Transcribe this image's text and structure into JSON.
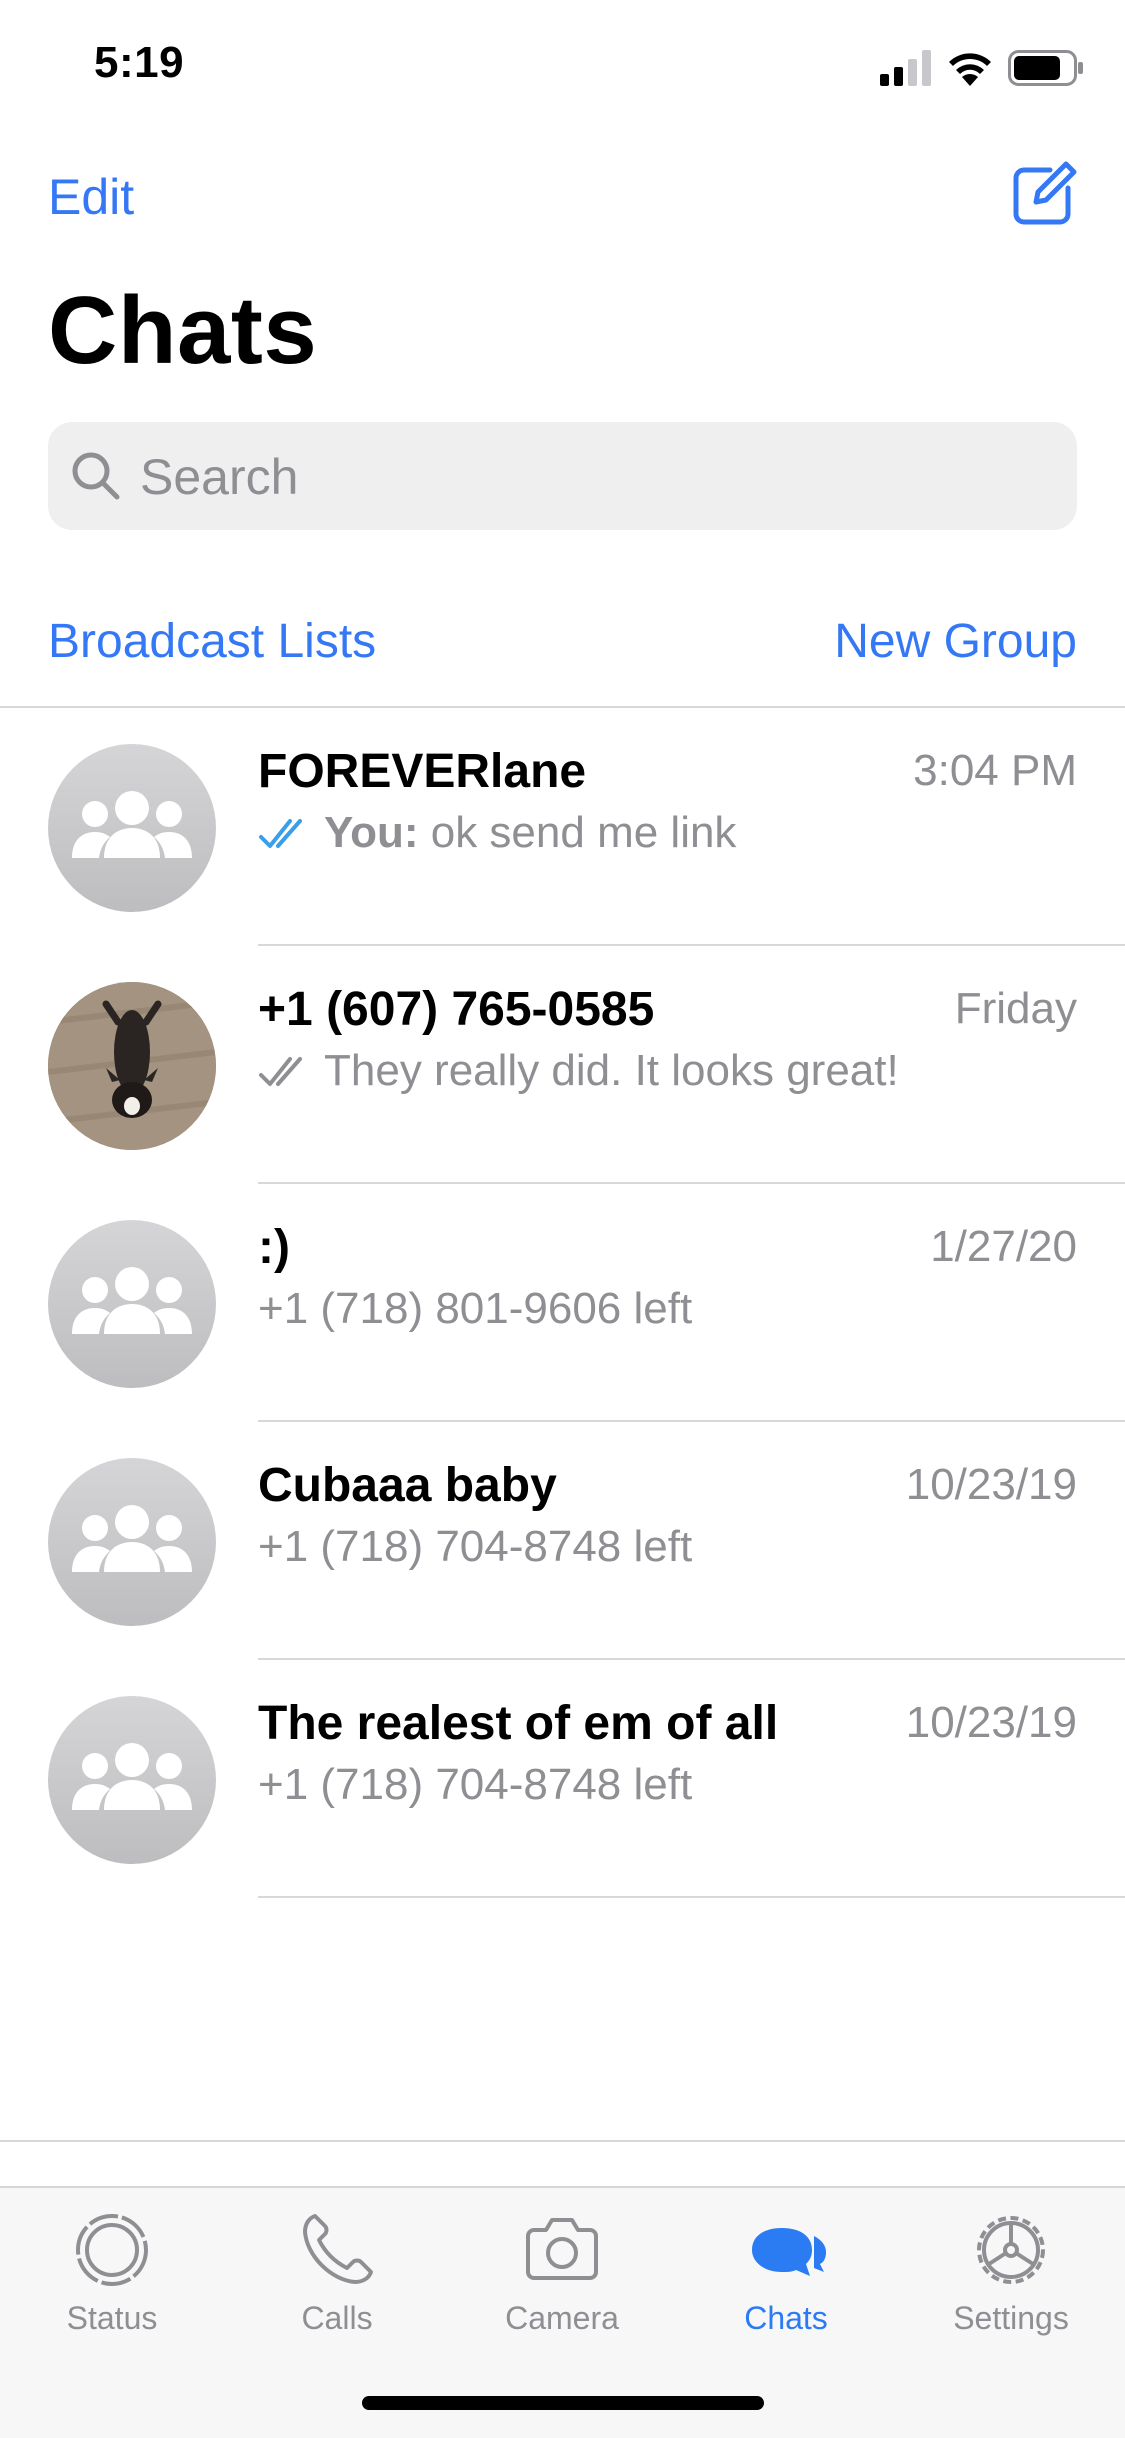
{
  "status_bar": {
    "time": "5:19"
  },
  "header": {
    "edit_label": "Edit",
    "title": "Chats"
  },
  "search": {
    "placeholder": "Search"
  },
  "actions": {
    "broadcast_label": "Broadcast Lists",
    "new_group_label": "New Group"
  },
  "colors": {
    "accent": "#3478f6",
    "secondary_text": "#8e8e93",
    "read_ticks": "#3a9ee8"
  },
  "chats": [
    {
      "name": "FOREVERlane",
      "time": "3:04 PM",
      "sender": "You:",
      "message": "ok send me link",
      "ticks": "read",
      "avatar": "group-icon"
    },
    {
      "name": "+1 (607) 765-0585",
      "time": "Friday",
      "sender": "",
      "message": "They really did.  It looks great!",
      "ticks": "delivered",
      "avatar": "dog-photo"
    },
    {
      "name": ":)",
      "time": "1/27/20",
      "sender": "",
      "message": "+1 (718) 801-9606 left",
      "ticks": "none",
      "avatar": "group-icon"
    },
    {
      "name": "Cubaaa baby",
      "time": "10/23/19",
      "sender": "",
      "message": "+1 (718) 704-8748 left",
      "ticks": "none",
      "avatar": "group-icon"
    },
    {
      "name": "The realest of em of all",
      "time": "10/23/19",
      "sender": "",
      "message": "+1 (718) 704-8748 left",
      "ticks": "none",
      "avatar": "group-icon"
    }
  ],
  "tabbar": {
    "tabs": [
      {
        "label": "Status",
        "icon": "status-icon"
      },
      {
        "label": "Calls",
        "icon": "phone-icon"
      },
      {
        "label": "Camera",
        "icon": "camera-icon"
      },
      {
        "label": "Chats",
        "icon": "chat-bubbles-icon",
        "active": true
      },
      {
        "label": "Settings",
        "icon": "gear-icon"
      }
    ]
  }
}
